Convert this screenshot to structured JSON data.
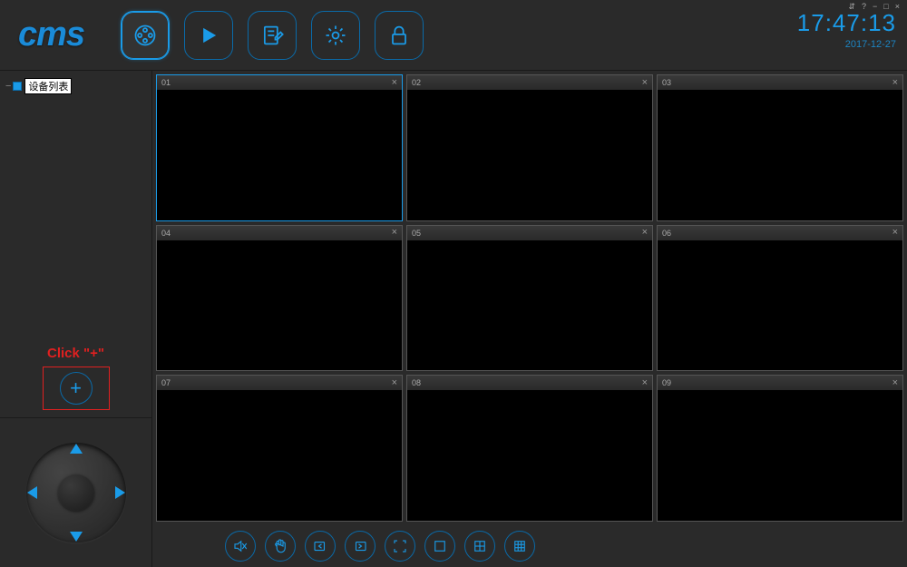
{
  "header": {
    "logo": "cms",
    "time": "17:47:13",
    "date": "2017-12-27",
    "winctrls": {
      "switch": "⇵",
      "help": "?",
      "min": "−",
      "restore": "□",
      "close": "×"
    }
  },
  "sidebar": {
    "tree_root": "设备列表",
    "click_hint": "Click \"+\"",
    "add_symbol": "+"
  },
  "channels": [
    {
      "id": "01",
      "selected": true
    },
    {
      "id": "02",
      "selected": false
    },
    {
      "id": "03",
      "selected": false
    },
    {
      "id": "04",
      "selected": false
    },
    {
      "id": "05",
      "selected": false
    },
    {
      "id": "06",
      "selected": false
    },
    {
      "id": "07",
      "selected": false
    },
    {
      "id": "08",
      "selected": false
    },
    {
      "id": "09",
      "selected": false
    }
  ],
  "close_symbol": "×"
}
